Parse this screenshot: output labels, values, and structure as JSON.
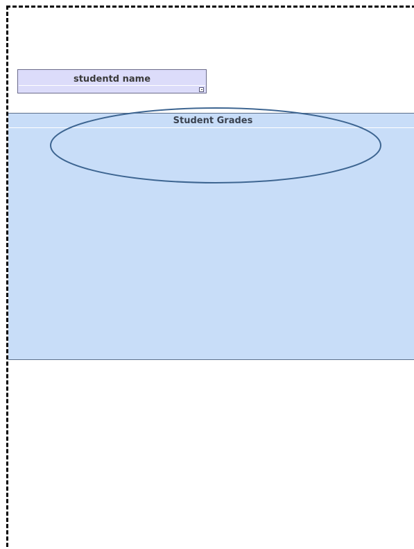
{
  "student_name_field": {
    "label": "studentd name"
  },
  "grades_panel": {
    "title": "Student Grades"
  },
  "colors": {
    "field_background": "#dcdcfa",
    "panel_background": "#c8ddf8",
    "annotation_stroke": "#3d6591",
    "surface_border": "#000000"
  },
  "annotation": {
    "shape": "ellipse",
    "highlights": "grades-title"
  }
}
